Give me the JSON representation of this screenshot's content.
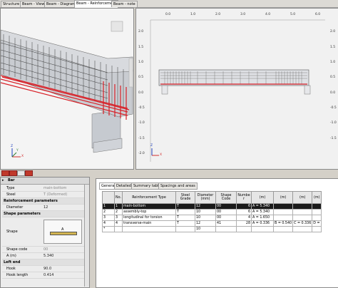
{
  "tabs": [
    "Structure",
    "Beam - View",
    "Beam - Diagrams",
    "Beam - Reinforcement",
    "Beam - note"
  ],
  "active_tab": 3,
  "view3d": {
    "axis": {
      "x": "X",
      "y": "Y",
      "z": "Z"
    }
  },
  "view2d": {
    "top_ruler": [
      "0.0",
      "1.0",
      "2.0",
      "3.0",
      "4.0",
      "5.0",
      "6.0"
    ],
    "left_ruler": [
      "2.0",
      "1.5",
      "1.0",
      "0.5",
      "0.0",
      "-0.5",
      "-1.0",
      "-1.5",
      "-2.0"
    ],
    "right_ruler": [
      "2.0",
      "1.5",
      "1.0",
      "0.5",
      "0.0",
      "-0.5",
      "-1.0",
      "-1.5"
    ],
    "axis": {
      "x": "X",
      "z": "Z"
    }
  },
  "props": {
    "header": "Bar",
    "rows": [
      {
        "k": "Type",
        "v": "main-bottom",
        "ro": true
      },
      {
        "k": "Steel",
        "v": "T (Deformed)",
        "ro": true
      },
      {
        "k": "Reinforcement parameters",
        "v": "",
        "sec": true
      },
      {
        "k": "Diameter",
        "v": "12"
      },
      {
        "k": "Shape parameters",
        "v": "",
        "sec": true
      },
      {
        "k": "Shape",
        "v": ""
      },
      {
        "k": "Shape code",
        "v": "00",
        "ro": true
      },
      {
        "k": "A (m)",
        "v": "5.340"
      },
      {
        "k": "Left end",
        "v": "",
        "sec": true
      },
      {
        "k": "Hook",
        "v": "90.0"
      },
      {
        "k": "Hook length",
        "v": "0.414"
      }
    ],
    "shape_label": "A"
  },
  "bottom_tabs": [
    "General",
    "Detailed",
    "Summary table",
    "Spacings and areas"
  ],
  "table": {
    "headers": [
      "",
      "No.",
      "Reinforcement Type",
      "Steel Grade",
      "Diameter (mm)",
      "Shape Code",
      "Numbe r",
      "(m)",
      "(m)",
      "(m)",
      "(m)"
    ],
    "rows": [
      [
        "1",
        "1",
        "main-bottom",
        "T",
        "12",
        "00",
        "6",
        "A = 5.340",
        "",
        "",
        ""
      ],
      [
        "2",
        "2",
        "assembly-top",
        "T",
        "10",
        "00",
        "6",
        "A = 5.340",
        "",
        "",
        ""
      ],
      [
        "3",
        "3",
        "longitudinal for torsion",
        "T",
        "10",
        "00",
        "4",
        "A = 1.650",
        "",
        "",
        ""
      ],
      [
        "4",
        "4",
        "transverse-main",
        "T",
        "12",
        "41",
        "28",
        "A = 0.336",
        "B = 0.540",
        "C = 0.336",
        "D ="
      ],
      [
        "*",
        "",
        "",
        "",
        "10",
        "",
        "",
        "",
        "",
        "",
        ""
      ]
    ],
    "selected": 0
  },
  "colors": {
    "bar_red": "#d81f26",
    "cage": "#404040",
    "concrete": "#b8bcc2"
  }
}
